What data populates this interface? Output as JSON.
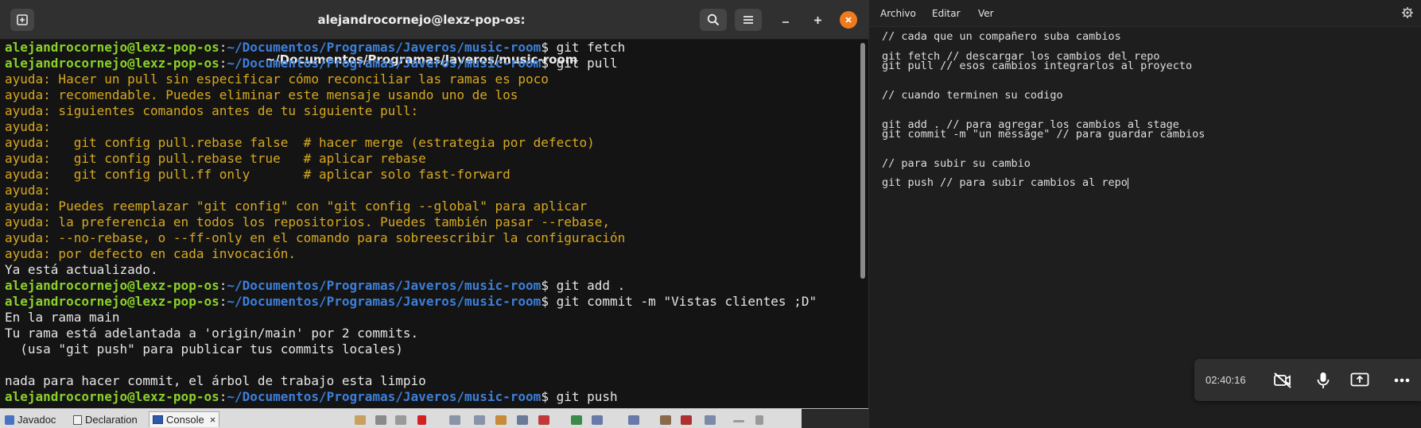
{
  "terminal": {
    "title": "alejandrocornejo@lexz-pop-os: ~/Documentos/Programas/Javeros/music-room",
    "prompt_user": "alejandrocornejo@lexz-pop-os",
    "prompt_colon": ":",
    "prompt_path": "~/Documentos/Programas/Javeros/music-room",
    "prompt_symbol": "$ ",
    "lines": [
      {
        "kind": "prompt",
        "cmd": "git fetch"
      },
      {
        "kind": "prompt",
        "cmd": "git pull"
      },
      {
        "kind": "hint",
        "text": "ayuda: Hacer un pull sin especificar cómo reconciliar las ramas es poco"
      },
      {
        "kind": "hint",
        "text": "ayuda: recomendable. Puedes eliminar este mensaje usando uno de los"
      },
      {
        "kind": "hint",
        "text": "ayuda: siguientes comandos antes de tu siguiente pull:"
      },
      {
        "kind": "hint",
        "text": "ayuda:"
      },
      {
        "kind": "hint",
        "text": "ayuda:   git config pull.rebase false  # hacer merge (estrategia por defecto)"
      },
      {
        "kind": "hint",
        "text": "ayuda:   git config pull.rebase true   # aplicar rebase"
      },
      {
        "kind": "hint",
        "text": "ayuda:   git config pull.ff only       # aplicar solo fast-forward"
      },
      {
        "kind": "hint",
        "text": "ayuda:"
      },
      {
        "kind": "hint",
        "text": "ayuda: Puedes reemplazar \"git config\" con \"git config --global\" para aplicar"
      },
      {
        "kind": "hint",
        "text": "ayuda: la preferencia en todos los repositorios. Puedes también pasar --rebase,"
      },
      {
        "kind": "hint",
        "text": "ayuda: --no-rebase, o --ff-only en el comando para sobreescribir la configuración"
      },
      {
        "kind": "hint",
        "text": "ayuda: por defecto en cada invocación."
      },
      {
        "kind": "out",
        "text": "Ya está actualizado."
      },
      {
        "kind": "prompt",
        "cmd": "git add ."
      },
      {
        "kind": "prompt",
        "cmd": "git commit -m \"Vistas clientes ;D\""
      },
      {
        "kind": "out",
        "text": "En la rama main"
      },
      {
        "kind": "out",
        "text": "Tu rama está adelantada a 'origin/main' por 2 commits."
      },
      {
        "kind": "out",
        "text": "  (usa \"git push\" para publicar tus commits locales)"
      },
      {
        "kind": "out",
        "text": ""
      },
      {
        "kind": "out",
        "text": "nada para hacer commit, el árbol de trabajo esta limpio"
      },
      {
        "kind": "prompt",
        "cmd": "git push"
      }
    ]
  },
  "eclipse": {
    "tabs": [
      {
        "label": "Javadoc"
      },
      {
        "label": "Declaration"
      },
      {
        "label": "Console",
        "close": "×",
        "active": true
      }
    ]
  },
  "editor": {
    "menu": [
      "Archivo",
      "Editar",
      "Ver"
    ],
    "lines": [
      "// cada que un compañero suba cambios",
      "",
      "git fetch // descargar los cambios del repo",
      "git pull // esos cambios integrarlos al proyecto",
      "",
      "",
      "// cuando terminen su codigo",
      "",
      "",
      "git add . // para agregar los cambios al stage",
      "git commit -m \"un message\" // para guardar cambios",
      "",
      "",
      "// para subir su cambio",
      "",
      "git push // para subir cambios al repo"
    ]
  },
  "call": {
    "timer": "02:40:16",
    "icons": [
      "camera-off-icon",
      "microphone-icon",
      "share-screen-icon",
      "more-icon"
    ]
  },
  "colors": {
    "prompt_user": "#8bd12a",
    "prompt_path": "#3d7fd9",
    "hint": "#d8a820",
    "close_button": "#f07b1d"
  }
}
